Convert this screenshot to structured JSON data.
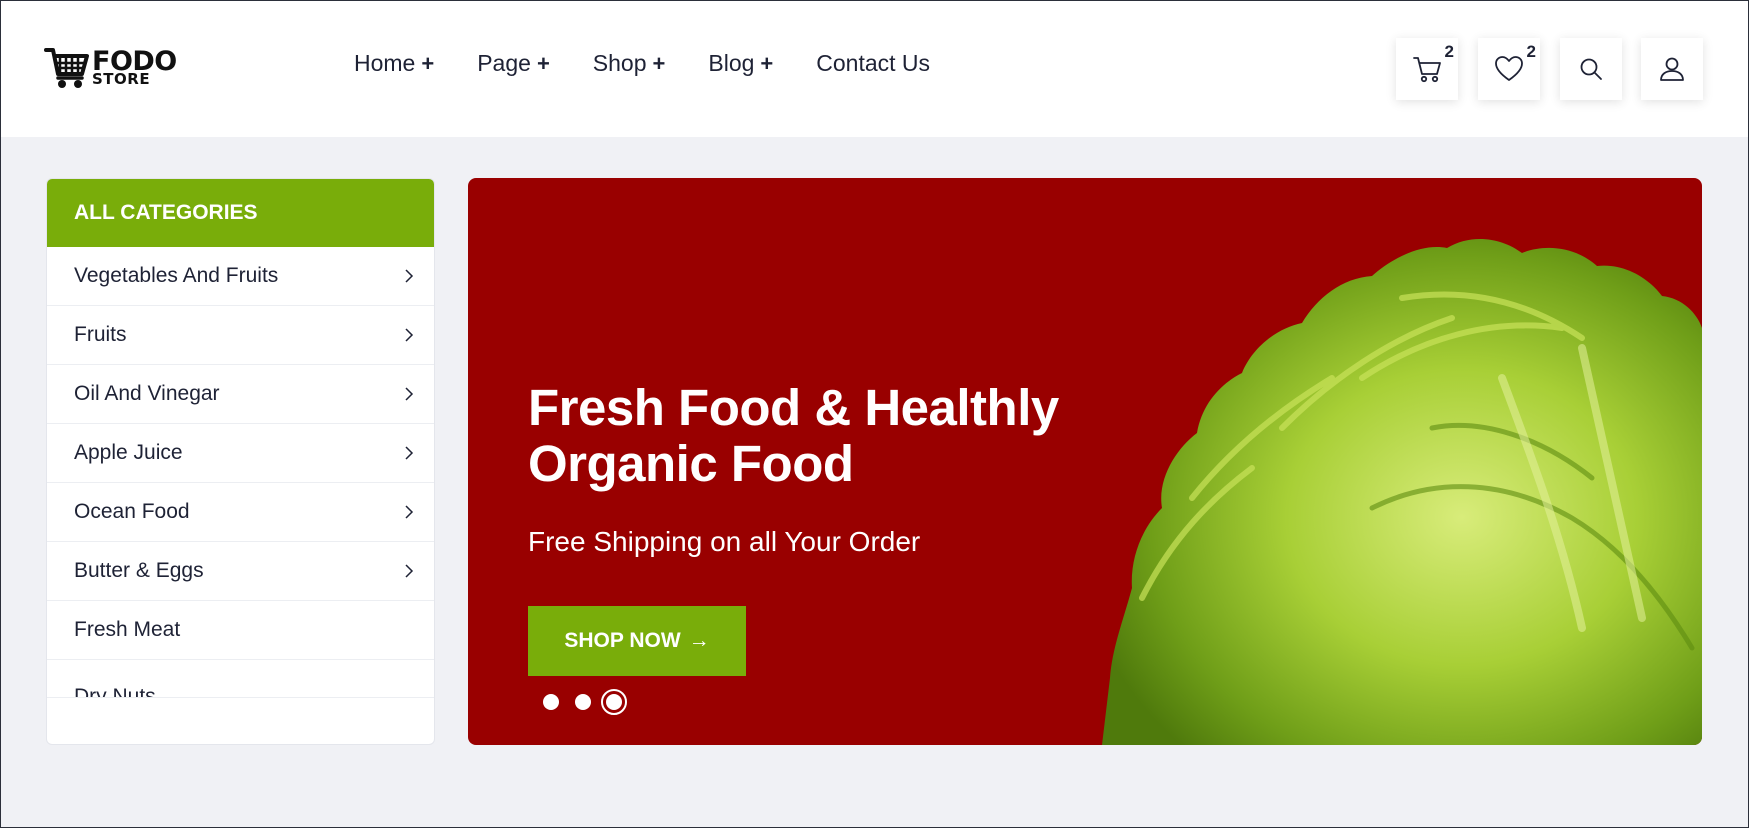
{
  "brand": {
    "name": "FODO",
    "tagline": "STORE"
  },
  "nav": [
    {
      "label": "Home",
      "suffix": "+"
    },
    {
      "label": "Page",
      "suffix": "+"
    },
    {
      "label": "Shop",
      "suffix": "+"
    },
    {
      "label": "Blog",
      "suffix": "+"
    },
    {
      "label": "Contact Us",
      "suffix": ""
    }
  ],
  "header_actions": {
    "cart": {
      "icon": "cart-icon",
      "count": "2"
    },
    "wishlist": {
      "icon": "heart-icon",
      "count": "2"
    },
    "search": {
      "icon": "search-icon"
    },
    "account": {
      "icon": "user-icon"
    }
  },
  "sidebar": {
    "title": "ALL CATEGORIES",
    "items": [
      {
        "label": "Vegetables And Fruits",
        "has_children": true
      },
      {
        "label": "Fruits",
        "has_children": true
      },
      {
        "label": "Oil And Vinegar",
        "has_children": true
      },
      {
        "label": "Apple Juice",
        "has_children": true
      },
      {
        "label": "Ocean Food",
        "has_children": true
      },
      {
        "label": "Butter & Eggs",
        "has_children": true
      },
      {
        "label": "Fresh Meat",
        "has_children": false
      },
      {
        "label": "Dry Nuts",
        "has_children": false
      }
    ]
  },
  "hero": {
    "title_line1": "Fresh Food & Healthly",
    "title_line2": "Organic Food",
    "subtitle": "Free Shipping on all Your Order",
    "cta_label": "SHOP NOW",
    "cta_arrow": "→",
    "slide_count": 3,
    "active_slide": 3
  },
  "colors": {
    "accent_green": "#79ad0a",
    "hero_red": "#990000",
    "text_dark": "#1e2235",
    "page_bg": "#f0f1f5"
  }
}
